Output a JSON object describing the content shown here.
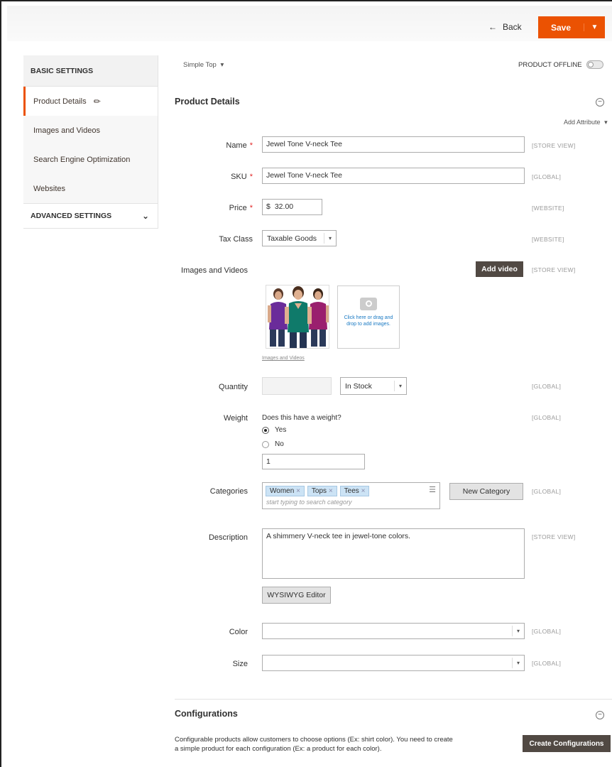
{
  "header": {
    "back_label": "Back",
    "back_arrow": "←",
    "save_label": "Save",
    "save_caret": "▼"
  },
  "sidebar": {
    "basic_settings": "BASIC SETTINGS",
    "items": [
      {
        "label": "Product Details",
        "active": true
      },
      {
        "label": "Images and Videos"
      },
      {
        "label": "Search Engine Optimization"
      },
      {
        "label": "Websites"
      }
    ],
    "advanced_settings": "ADVANCED SETTINGS",
    "pencil_glyph": "✏",
    "chevron_glyph": "⌄"
  },
  "toolbar": {
    "attribute_set": "Simple Top",
    "attribute_set_caret": "▾",
    "product_status": "PRODUCT OFFLINE"
  },
  "product_details": {
    "title": "Product Details",
    "collapse_glyph": "−",
    "add_attribute": "Add Attribute",
    "add_attribute_caret": "▾",
    "required_mark": "*",
    "name": {
      "label": "Name",
      "value": "Jewel Tone V-neck Tee",
      "scope": "[STORE VIEW]"
    },
    "sku": {
      "label": "SKU",
      "value": "Jewel Tone V-neck Tee",
      "scope": "[GLOBAL]"
    },
    "price": {
      "label": "Price",
      "currency": "$",
      "value": "32.00",
      "scope": "[WEBSITE]"
    },
    "tax_class": {
      "label": "Tax Class",
      "value": "Taxable Goods",
      "scope": "[WEBSITE]"
    },
    "images": {
      "label": "Images and Videos",
      "add_video": "Add video",
      "scope": "[STORE VIEW]",
      "upload_text": "Click here or drag and drop to add images.",
      "link_text": "Images and Videos"
    },
    "quantity": {
      "label": "Quantity",
      "value": "",
      "stock_status": "In Stock",
      "scope": "[GLOBAL]"
    },
    "weight": {
      "label": "Weight",
      "question": "Does this have a weight?",
      "options": [
        "Yes",
        "No"
      ],
      "selected": "Yes",
      "value": "1",
      "scope": "[GLOBAL]"
    },
    "categories": {
      "label": "Categories",
      "tags": [
        "Women",
        "Tops",
        "Tees"
      ],
      "placeholder": "start typing to search category",
      "new_category": "New Category",
      "scope": "[GLOBAL]"
    },
    "description": {
      "label": "Description",
      "value": "A shimmery V-neck tee in jewel-tone colors.",
      "editor_button": "WYSIWYG Editor",
      "scope": "[STORE VIEW]"
    },
    "color": {
      "label": "Color",
      "value": "",
      "scope": "[GLOBAL]"
    },
    "size": {
      "label": "Size",
      "value": "",
      "scope": "[GLOBAL]"
    },
    "select_caret": "▾"
  },
  "configurations": {
    "title": "Configurations",
    "collapse_glyph": "−",
    "description": "Configurable products allow customers to choose options (Ex: shirt color). You need to create a simple product for each configuration (Ex: a product for each color).",
    "create_button": "Create Configurations"
  },
  "colors": {
    "accent": "#eb5202",
    "dark_button": "#514943",
    "tag_bg": "#cce3f5"
  }
}
